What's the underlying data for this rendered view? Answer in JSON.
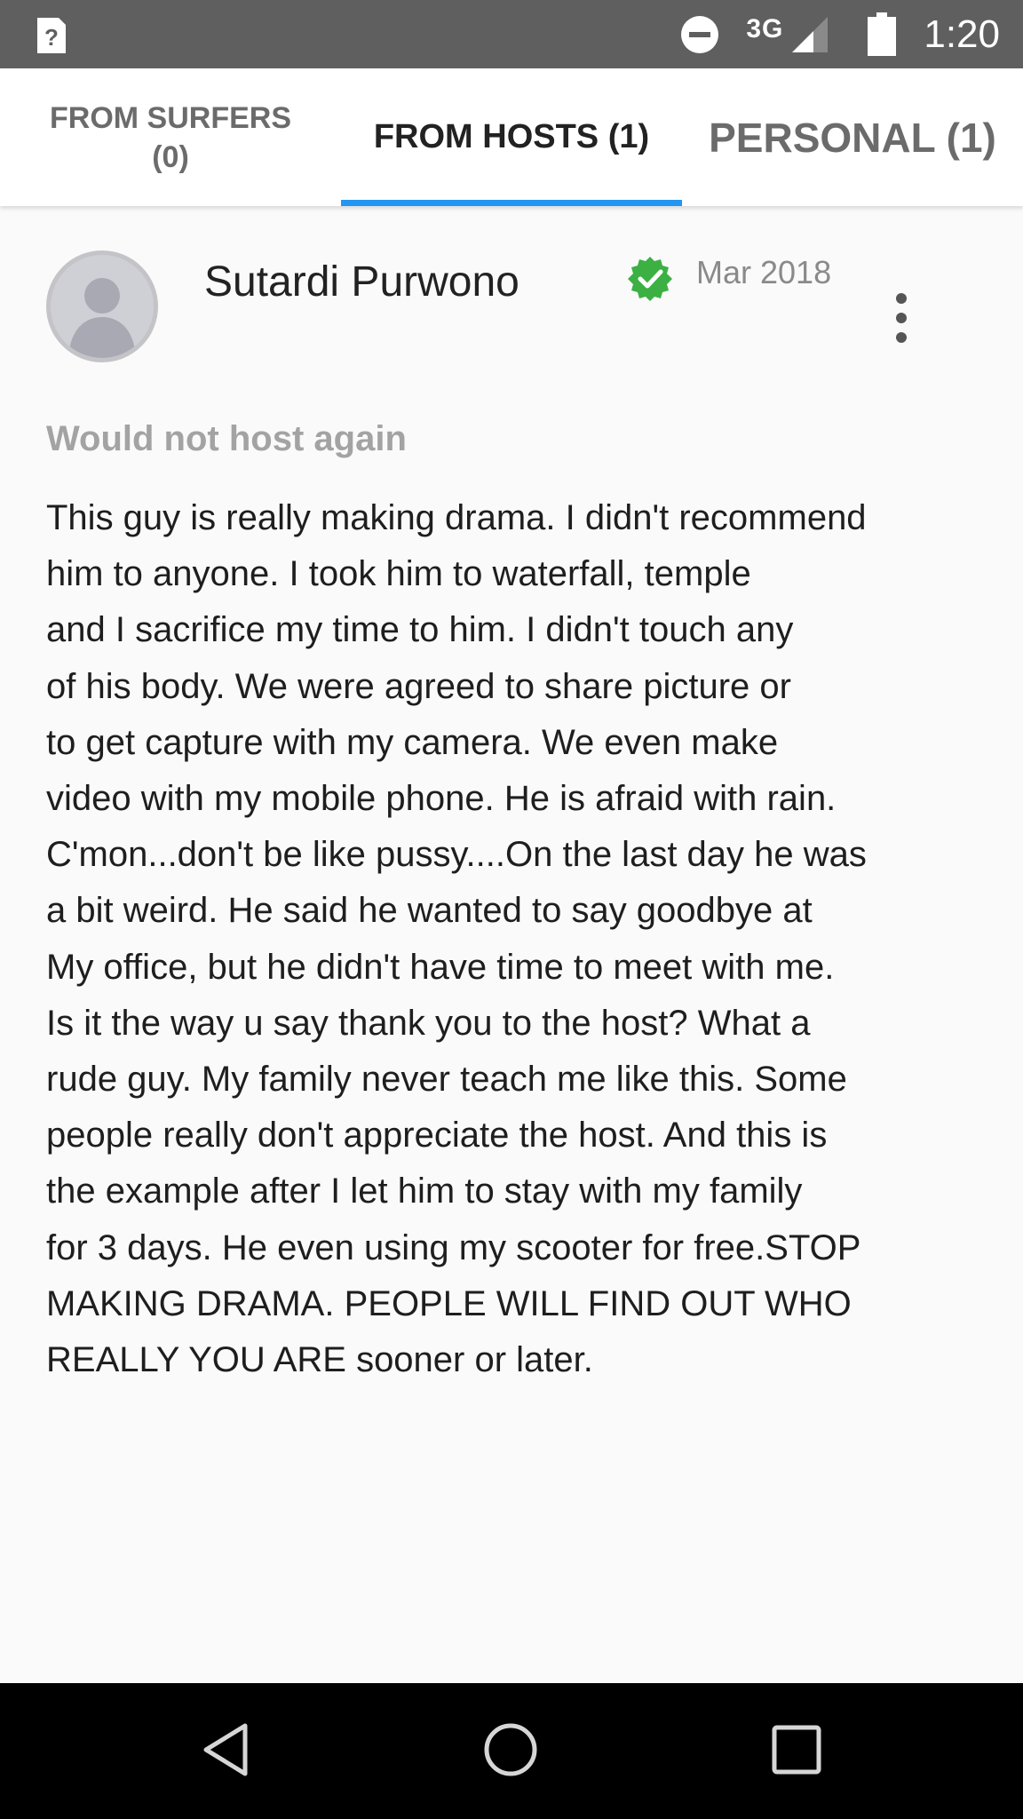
{
  "status_bar": {
    "network": "3G",
    "time": "1:20",
    "icons": [
      "unknown-sim-icon",
      "do-not-disturb-icon",
      "signal-icon",
      "battery-icon"
    ]
  },
  "tabs": [
    {
      "label": "FROM SURFERS (0)",
      "active": false
    },
    {
      "label": "FROM HOSTS (1)",
      "active": true
    },
    {
      "label": "PERSONAL (1)",
      "active": false
    }
  ],
  "review": {
    "author": "Sutardi Purwono",
    "date": "Mar 2018",
    "verified": true,
    "recommendation": "Would not host again",
    "body_lines": [
      "This guy is really making drama. I didn't recommend",
      "him to anyone. I took him to waterfall, temple",
      "and I sacrifice my time to him. I didn't touch any",
      "of his body. We were agreed to share picture or",
      "to get capture with my camera. We even make",
      "video with my mobile phone. He is afraid with rain.",
      "C'mon...don't be like pussy....On the last day he was",
      "a bit weird. He said he wanted to say goodbye at",
      "My office, but he didn't have time to meet with me.",
      "Is it the way u say thank you to the host? What a",
      "rude guy. My family never teach me like this. Some",
      "people really don't appreciate the host. And this is",
      "the example after I let him to stay with my family",
      "for 3 days. He even using my scooter for free.STOP",
      "MAKING DRAMA. PEOPLE WILL FIND OUT WHO",
      "REALLY YOU ARE sooner or later."
    ]
  },
  "colors": {
    "status_bar": "#5f5f5f",
    "tab_indicator": "#2196f3",
    "verified": "#3cb043",
    "nav_bar": "#000000"
  }
}
